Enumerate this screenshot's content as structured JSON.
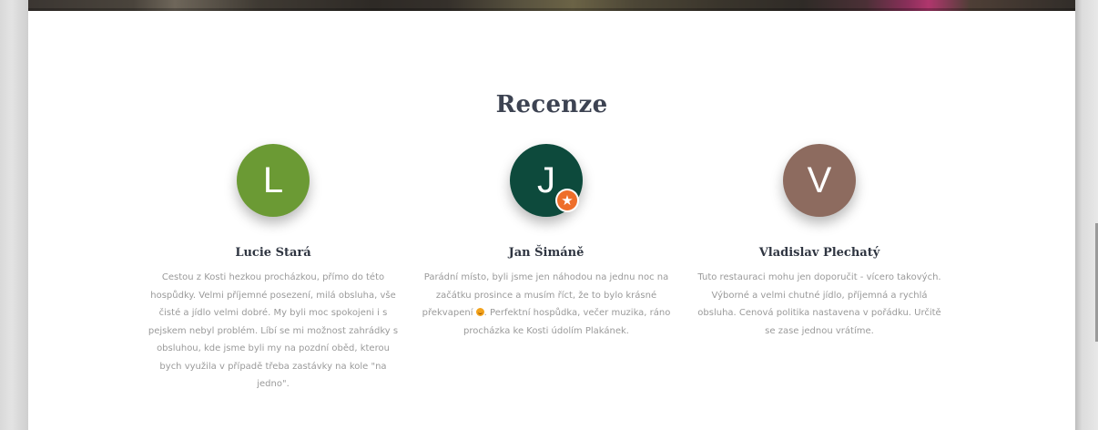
{
  "section": {
    "title": "Recenze"
  },
  "colors": {
    "title": "#3d4352",
    "text_muted": "#9a9a9a",
    "badge": "#ee6e2a"
  },
  "reviews": [
    {
      "initial": "L",
      "avatar_color": "#6b9a34",
      "name": "Lucie Stará",
      "text": "Cestou z Kosti hezkou procházkou, přímo do této hospůdky. Velmi příjemné posezení, milá obsluha, vše čisté a jídlo velmi dobré. My byli moc spokojeni i s pejskem nebyl problém. Líbí se mi možnost zahrádky s obsluhou, kde jsme byli my na pozdní oběd, kterou bych využila v případě třeba zastávky na kole \"na jedno\"."
    },
    {
      "initial": "J",
      "avatar_color": "#0d4a3c",
      "badge_icon": "local-guide-star-icon",
      "name": "Jan Šimáně",
      "text_part1": "Parádní místo, byli jsme jen náhodou na jednu noc na začátku prosince a musím říct, že to bylo krásné překvapení",
      "emoji_icon": "smiling-face-emoji-icon",
      "text_part2": ". Perfektní hospůdka, večer muzika, ráno procházka ke Kosti údolím Plakánek."
    },
    {
      "initial": "V",
      "avatar_color": "#8d6b5f",
      "name": "Vladislav Plechatý",
      "text": "Tuto restauraci mohu jen doporučit - vícero takových. Výborné a velmi chutné jídlo, příjemná a rychlá obsluha. Cenová politika nastavena v pořádku. Určitě se zase jednou vrátíme."
    }
  ]
}
